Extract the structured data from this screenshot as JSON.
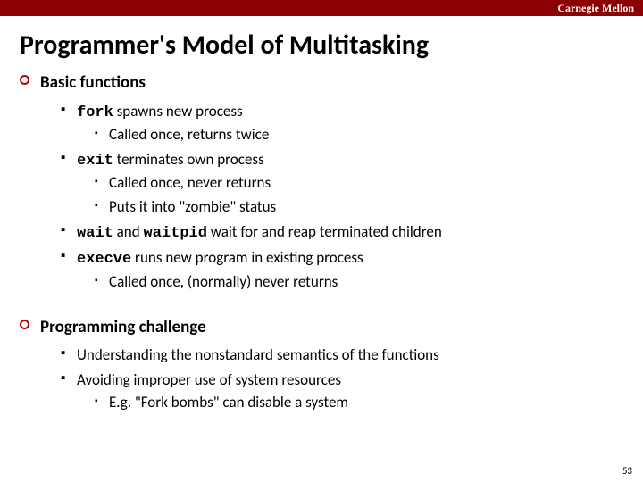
{
  "institution": "Carnegie Mellon",
  "title": "Programmer's Model of Multitasking",
  "page_number": "53",
  "sections": [
    {
      "heading": "Basic functions",
      "items": [
        {
          "code": "fork",
          "rest": " spawns new process",
          "sub": [
            {
              "text": "Called once, returns twice"
            }
          ]
        },
        {
          "code": "exit",
          "rest": " terminates own process",
          "sub": [
            {
              "text": "Called once, never returns"
            },
            {
              "text": "Puts it into \"zombie\" status"
            }
          ]
        },
        {
          "code": "wait",
          "rest": " and ",
          "code2": "waitpid",
          "rest2": " wait for and reap terminated children"
        },
        {
          "code": "execve",
          "rest": " runs new program in existing process",
          "sub": [
            {
              "text": "Called once, (normally) never returns"
            }
          ]
        }
      ]
    },
    {
      "heading": "Programming challenge",
      "items": [
        {
          "text": "Understanding the nonstandard semantics of the functions"
        },
        {
          "text": "Avoiding improper use of system resources",
          "sub": [
            {
              "text": "E.g. \"Fork bombs\" can disable a system"
            }
          ]
        }
      ]
    }
  ]
}
